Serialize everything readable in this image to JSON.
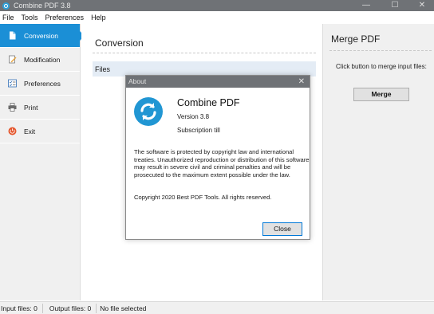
{
  "window": {
    "title": "Combine PDF 3.8",
    "controls": {
      "minimize": "—",
      "maximize": "☐",
      "close": "✕"
    }
  },
  "menu": [
    {
      "label": "File"
    },
    {
      "label": "Tools"
    },
    {
      "label": "Preferences"
    },
    {
      "label": "Help"
    }
  ],
  "sidebar": {
    "items": [
      {
        "label": "Conversion",
        "icon": "document-icon",
        "active": true
      },
      {
        "label": "Modification",
        "icon": "edit-document-icon",
        "active": false
      },
      {
        "label": "Preferences",
        "icon": "checklist-icon",
        "active": false
      },
      {
        "label": "Print",
        "icon": "printer-icon",
        "active": false
      },
      {
        "label": "Exit",
        "icon": "power-icon",
        "active": false
      }
    ]
  },
  "main": {
    "heading": "Conversion",
    "files_label": "Files"
  },
  "merge_panel": {
    "heading": "Merge PDF",
    "hint": "Click button to merge input files:",
    "button_label": "Merge"
  },
  "status": {
    "input_files": "Input files: 0",
    "output_files": "Output files: 0",
    "selection": "No file selected"
  },
  "about_dialog": {
    "title": "About",
    "close_glyph": "✕",
    "app_name": "Combine PDF",
    "version": "Version 3.8",
    "subscription": "Subscription till",
    "legal": "The software is protected by copyright law and international treaties. Unauthorized reproduction or distribution of this software may result in severe civil and criminal penalties and will be prosecuted to the maximum extent possible under the law.",
    "copyright": "Copyright 2020 Best PDF Tools. All rights reserved.",
    "close_label": "Close"
  },
  "colors": {
    "accent": "#1b8fd6",
    "titlebar": "#6f7276",
    "logo": "#2196d3"
  }
}
